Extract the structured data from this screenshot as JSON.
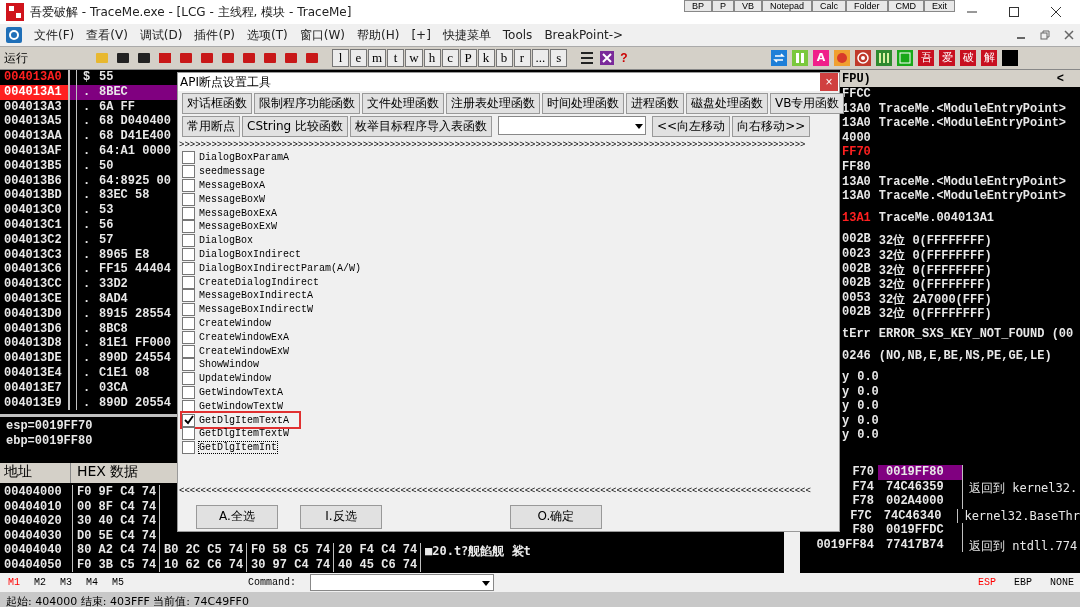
{
  "title_bar": {
    "title": "吾爱破解 - TraceMe.exe - [LCG - 主线程, 模块 - TraceMe]"
  },
  "quick_tools": [
    "BP",
    "P",
    "VB",
    "Notepad",
    "Calc",
    "Folder",
    "CMD",
    "Exit"
  ],
  "menu": [
    "文件(F)",
    "查看(V)",
    "调试(D)",
    "插件(P)",
    "选项(T)",
    "窗口(W)",
    "帮助(H)",
    "[+]",
    "快捷菜单",
    "Tools",
    "BreakPoint->"
  ],
  "toolbar": {
    "status": "运行",
    "letters": [
      "l",
      "e",
      "m",
      "t",
      "w",
      "h",
      "c",
      "P",
      "k",
      "b",
      "r",
      "...",
      "s"
    ],
    "help": "?",
    "badge": "A",
    "tiles": [
      "吾",
      "爱",
      "破",
      "解"
    ]
  },
  "disasm": {
    "rows": [
      {
        "address": "004013A0",
        "marker": "$",
        "hex": "55",
        "kind": "red-text",
        "selected": false
      },
      {
        "address": "004013A1",
        "marker": ".",
        "hex": "8BEC",
        "kind": "red-fill",
        "selected": true
      },
      {
        "address": "004013A3",
        "marker": ".",
        "hex": "6A FF",
        "kind": "none",
        "selected": false
      },
      {
        "address": "004013A5",
        "marker": ".",
        "hex": "68 D040400",
        "kind": "none",
        "selected": false
      },
      {
        "address": "004013AA",
        "marker": ".",
        "hex": "68 D41E400",
        "kind": "none",
        "selected": false
      },
      {
        "address": "004013AF",
        "marker": ".",
        "hex": "64:A1 0000",
        "kind": "none",
        "selected": false
      },
      {
        "address": "004013B5",
        "marker": ".",
        "hex": "50",
        "kind": "none",
        "selected": false
      },
      {
        "address": "004013B6",
        "marker": ".",
        "hex": "64:8925 00",
        "kind": "none",
        "selected": false
      },
      {
        "address": "004013BD",
        "marker": ".",
        "hex": "83EC 58",
        "kind": "none",
        "selected": false
      },
      {
        "address": "004013C0",
        "marker": ".",
        "hex": "53",
        "kind": "none",
        "selected": false
      },
      {
        "address": "004013C1",
        "marker": ".",
        "hex": "56",
        "kind": "none",
        "selected": false
      },
      {
        "address": "004013C2",
        "marker": ".",
        "hex": "57",
        "kind": "none",
        "selected": false
      },
      {
        "address": "004013C3",
        "marker": ".",
        "hex": "8965 E8",
        "kind": "none",
        "selected": false
      },
      {
        "address": "004013C6",
        "marker": ".",
        "hex": "FF15 44404",
        "kind": "none",
        "selected": false
      },
      {
        "address": "004013CC",
        "marker": ".",
        "hex": "33D2",
        "kind": "none",
        "selected": false
      },
      {
        "address": "004013CE",
        "marker": ".",
        "hex": "8AD4",
        "kind": "none",
        "selected": false
      },
      {
        "address": "004013D0",
        "marker": ".",
        "hex": "8915 28554",
        "kind": "none",
        "selected": false
      },
      {
        "address": "004013D6",
        "marker": ".",
        "hex": "8BC8",
        "kind": "none",
        "selected": false
      },
      {
        "address": "004013D8",
        "marker": ".",
        "hex": "81E1 FF000",
        "kind": "none",
        "selected": false
      },
      {
        "address": "004013DE",
        "marker": ".",
        "hex": "890D 24554",
        "kind": "none",
        "selected": false
      },
      {
        "address": "004013E4",
        "marker": ".",
        "hex": "C1E1 08",
        "kind": "none",
        "selected": false
      },
      {
        "address": "004013E7",
        "marker": ".",
        "hex": "03CA",
        "kind": "none",
        "selected": false
      },
      {
        "address": "004013E9",
        "marker": ".",
        "hex": "890D 20554",
        "kind": "none",
        "selected": false
      }
    ]
  },
  "info": [
    "esp=0019FF70",
    "ebp=0019FF80"
  ],
  "registers": {
    "title": "FPU)",
    "collapse": "<",
    "sections": [
      [
        {
          "value": "FFCC",
          "changed": false
        },
        {
          "value": "13A0",
          "note": "TraceMe.<ModuleEntryPoint>",
          "changed": false
        },
        {
          "value": "13A0",
          "note": "TraceMe.<ModuleEntryPoint>",
          "changed": false
        },
        {
          "value": "4000",
          "changed": false
        },
        {
          "value": "FF70",
          "changed": true
        },
        {
          "value": "FF80",
          "changed": false
        },
        {
          "value": "13A0",
          "note": "TraceMe.<ModuleEntryPoint>",
          "changed": false
        },
        {
          "value": "13A0",
          "note": "TraceMe.<ModuleEntryPoint>",
          "changed": false
        }
      ],
      [
        {
          "value": "13A1",
          "note": "TraceMe.004013A1",
          "changed": true
        }
      ],
      [
        {
          "value": "002B",
          "note": "32位 0(FFFFFFFF)",
          "changed": false
        },
        {
          "value": "0023",
          "note": "32位 0(FFFFFFFF)",
          "changed": false
        },
        {
          "value": "002B",
          "note": "32位 0(FFFFFFFF)",
          "changed": false
        },
        {
          "value": "002B",
          "note": "32位 0(FFFFFFFF)",
          "changed": false
        },
        {
          "value": "0053",
          "note": "32位 2A7000(FFF)",
          "changed": false
        },
        {
          "value": "002B",
          "note": "32位 0(FFFFFFFF)",
          "changed": false
        }
      ],
      [
        {
          "value": "tErr",
          "note": "ERROR_SXS_KEY_NOT_FOUND (00",
          "changed": false
        }
      ],
      [
        {
          "value": "0246",
          "note": "(NO,NB,E,BE,NS,PE,GE,LE)",
          "changed": false
        }
      ],
      [
        {
          "value": "y",
          "note": "0.0",
          "changed": false
        },
        {
          "value": "y",
          "note": "0.0",
          "changed": false
        },
        {
          "value": "y",
          "note": "0.0",
          "changed": false
        },
        {
          "value": "y",
          "note": "0.0",
          "changed": false
        },
        {
          "value": "y",
          "note": "0.0",
          "changed": false
        }
      ]
    ]
  },
  "dump": {
    "columns": [
      "地址",
      "HEX 数据"
    ],
    "rows": [
      {
        "address": "00404000",
        "hex": [
          "F0 9F C4 74"
        ]
      },
      {
        "address": "00404010",
        "hex": [
          "00 8F C4 74"
        ]
      },
      {
        "address": "00404020",
        "hex": [
          "30 40 C4 74"
        ]
      },
      {
        "address": "00404030",
        "hex": [
          "D0 5E C4 74"
        ]
      },
      {
        "address": "00404040",
        "hex": [
          "80 A2 C4 74",
          "B0 2C C5 74",
          "F0 58 C5 74",
          "20 F4 C4 74"
        ],
        "ascii": "■20.t?舰餡舰 裟t"
      },
      {
        "address": "00404050",
        "hex": [
          "F0 3B C5 74",
          "10 62 C6 74",
          "30 97 C4 74",
          "40 45 C6 74"
        ]
      }
    ]
  },
  "stack": {
    "rows": [
      {
        "address": "F70",
        "value": "0019FF80",
        "selected": true
      },
      {
        "address": "F74",
        "value": "74C46359",
        "comment": "返回到 kernel32.",
        "selected": false
      },
      {
        "address": "F78",
        "value": "002A4000",
        "selected": false
      },
      {
        "address": "F7C",
        "value": "74C46340",
        "comment": "kernel32.BaseThr",
        "selected": false
      },
      {
        "address": "F80",
        "value": "0019FFDC",
        "selected": false
      },
      {
        "address": "0019FF84",
        "value": "77417B74",
        "comment": "返回到 ntdll.774",
        "selected": false
      }
    ]
  },
  "dialog": {
    "title": "API断点设置工具",
    "close": "×",
    "tabs_row1": [
      "对话框函数",
      "限制程序功能函数",
      "文件处理函数",
      "注册表处理函数",
      "时间处理函数",
      "进程函数",
      "磁盘处理函数",
      "VB专用函数"
    ],
    "tabs_row2": [
      "常用断点",
      "CString 比较函数",
      "枚举目标程序导入表函数"
    ],
    "move_buttons": [
      "<<向左移动",
      "向右移动>>"
    ],
    "forward_arrows": ">>>>>>>>>>>>>>>>>>>>>>>>>>>>>>>>>>>>>>>>>>>>>>>>>>>>>>>>>>>>>>>>>>>>>>>>>>>>>>>>>>>>>>>>>>>>>>>>>>>>>>>>>>>>>>>>>>>>",
    "items": [
      {
        "label": "DialogBoxParamA",
        "checked": false,
        "highlighted": false,
        "focused": false
      },
      {
        "label": "seedmessage",
        "checked": false,
        "highlighted": false,
        "focused": false
      },
      {
        "label": "MessageBoxA",
        "checked": false,
        "highlighted": false,
        "focused": false
      },
      {
        "label": "MessageBoxW",
        "checked": false,
        "highlighted": false,
        "focused": false
      },
      {
        "label": "MessageBoxExA",
        "checked": false,
        "highlighted": false,
        "focused": false
      },
      {
        "label": "MessageBoxExW",
        "checked": false,
        "highlighted": false,
        "focused": false
      },
      {
        "label": "DialogBox",
        "checked": false,
        "highlighted": false,
        "focused": false
      },
      {
        "label": "DialogBoxIndirect",
        "checked": false,
        "highlighted": false,
        "focused": false
      },
      {
        "label": "DialogBoxIndirectParam(A/W)",
        "checked": false,
        "highlighted": false,
        "focused": false
      },
      {
        "label": "CreateDialogIndirect",
        "checked": false,
        "highlighted": false,
        "focused": false
      },
      {
        "label": "MessageBoxIndirectA",
        "checked": false,
        "highlighted": false,
        "focused": false
      },
      {
        "label": "MessageBoxIndirectW",
        "checked": false,
        "highlighted": false,
        "focused": false
      },
      {
        "label": "CreateWindow",
        "checked": false,
        "highlighted": false,
        "focused": false
      },
      {
        "label": "CreateWindowExA",
        "checked": false,
        "highlighted": false,
        "focused": false
      },
      {
        "label": "CreateWindowExW",
        "checked": false,
        "highlighted": false,
        "focused": false
      },
      {
        "label": "ShowWindow",
        "checked": false,
        "highlighted": false,
        "focused": false
      },
      {
        "label": "UpdateWindow",
        "checked": false,
        "highlighted": false,
        "focused": false
      },
      {
        "label": "GetWindowTextA",
        "checked": false,
        "highlighted": false,
        "focused": false
      },
      {
        "label": "GetWindowTextW",
        "checked": false,
        "highlighted": false,
        "focused": false
      },
      {
        "label": "GetDlgItemTextA",
        "checked": true,
        "highlighted": true,
        "focused": false
      },
      {
        "label": "GetDlgItemTextW",
        "checked": false,
        "highlighted": false,
        "focused": false
      },
      {
        "label": "GetDlgItemInt",
        "checked": false,
        "highlighted": false,
        "focused": true
      }
    ],
    "back_arrows": "<<<<<<<<<<<<<<<<<<<<<<<<<<<<<<<<<<<<<<<<<<<<<<<<<<<<<<<<<<<<<<<<<<<<<<<<<<<<<<<<<<<<<<<<<<<<<<<<<<<<<<<<<<<<<<<<<<<<<",
    "buttons": [
      "A.全选",
      "I.反选",
      "O.确定"
    ]
  },
  "command_bar": {
    "memory_tabs": [
      {
        "label": "M1",
        "selected": true
      },
      {
        "label": "M2",
        "selected": false
      },
      {
        "label": "M3",
        "selected": false
      },
      {
        "label": "M4",
        "selected": false
      },
      {
        "label": "M5",
        "selected": false
      }
    ],
    "command_label": "Command:",
    "stack_modes": [
      {
        "label": "ESP",
        "selected": true
      },
      {
        "label": "EBP",
        "selected": false
      },
      {
        "label": "NONE",
        "selected": false
      }
    ]
  },
  "status_bar": "起始: 404000 结束: 403FFF 当前值: 74C49FF0"
}
